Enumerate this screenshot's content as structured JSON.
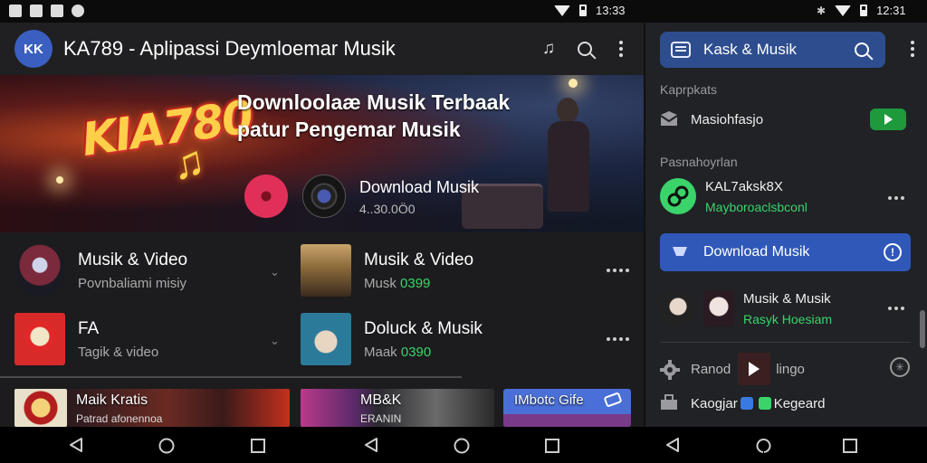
{
  "status_left_time": "13:33",
  "status_right_time": "12:31",
  "app": {
    "logo_text": "KK",
    "title": "KA789 - Aplipassi   Deymloemar Musik",
    "banner": {
      "logo_text": "KIA780",
      "headline_line1": "Downloolaæ Musik Terbaak",
      "headline_line2": "patur Pengemar Musik",
      "download_title": "Download Musik",
      "download_count": "4..30.0Ӧ0"
    },
    "items": [
      {
        "title": "Musik & Video",
        "sub": "Povnbaliami misiy",
        "num": ""
      },
      {
        "title": "Musik & Video",
        "sub": "Musk",
        "num": "0399"
      },
      {
        "title": "FA",
        "sub": "Tagik & video",
        "num": ""
      },
      {
        "title": "Doluck & Musik",
        "sub": "Maak",
        "num": "0390"
      }
    ],
    "strip": [
      {
        "label": "Maik Kratis",
        "sub": "Patrad afonennoa"
      },
      {
        "label": "MB&K",
        "sub": "ERANIN"
      },
      {
        "label": "IMbotc Gife",
        "sub": ""
      }
    ]
  },
  "panel": {
    "search_text": "Kask & Musik",
    "section1": "Kaprpkats",
    "row_settings": "Masiohfasjo",
    "section2": "Pasnahoyrlan",
    "profile_name": "KAL7aksk8X",
    "profile_sub": "Mayboroaclsbconl",
    "download_button": "Download Musik",
    "info_glyph": "!",
    "musik_title": "Musik & Musik",
    "musik_sub": "Rasyk Hoesiam",
    "row_ranod_a": "Ranod",
    "row_ranod_b": "lingo",
    "row_kaogjar_a": "Kaogjar",
    "row_kaogjar_b": "Kegeard"
  },
  "colors": {
    "accent_blue": "#2f58b8",
    "green": "#3ad46a",
    "toggle_green": "#1e9a3c",
    "pink": "#e0305a"
  },
  "icons": [
    "music-note-icon",
    "search-icon",
    "more-vert-icon",
    "chevron-down-icon",
    "more-horiz-icon",
    "chat-icon",
    "mail-icon",
    "play-icon",
    "link-icon",
    "info-icon",
    "gear-icon",
    "grid-icon",
    "back-icon",
    "home-icon",
    "recents-icon",
    "wifi-icon",
    "battery-icon"
  ]
}
